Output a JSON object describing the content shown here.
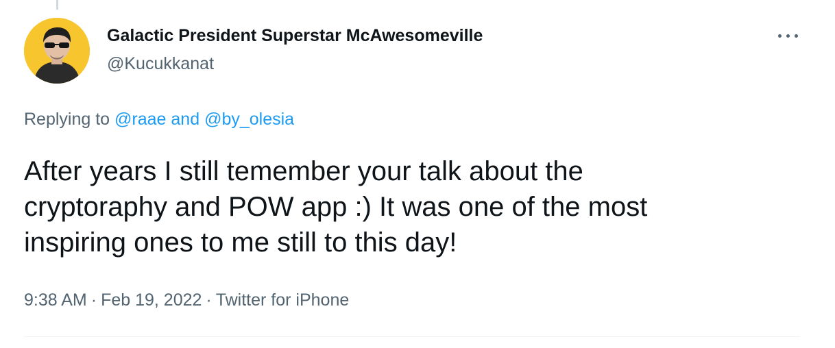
{
  "tweet": {
    "author": {
      "name": "Galactic President Superstar McAwesomeville",
      "handle": "@Kucukkanat",
      "avatar_bg": "#f7c52e"
    },
    "replying": {
      "prefix": "Replying to ",
      "mention_1": "@raae",
      "conjunction": " and ",
      "mention_2": "@by_olesia"
    },
    "text_lines": [
      "After years I still temember your talk about the",
      "cryptoraphy and POW app :) It was one of the most",
      "inspiring ones to me still to this day!"
    ],
    "meta": {
      "time": "9:38 AM",
      "separator": "·",
      "date": "Feb 19, 2022",
      "source": "Twitter for iPhone"
    },
    "more_icon": "more-horizontal-icon"
  },
  "colors": {
    "text_primary": "#0f1419",
    "text_secondary": "#536471",
    "link": "#1d9bf0",
    "divider": "#eff3f4"
  }
}
